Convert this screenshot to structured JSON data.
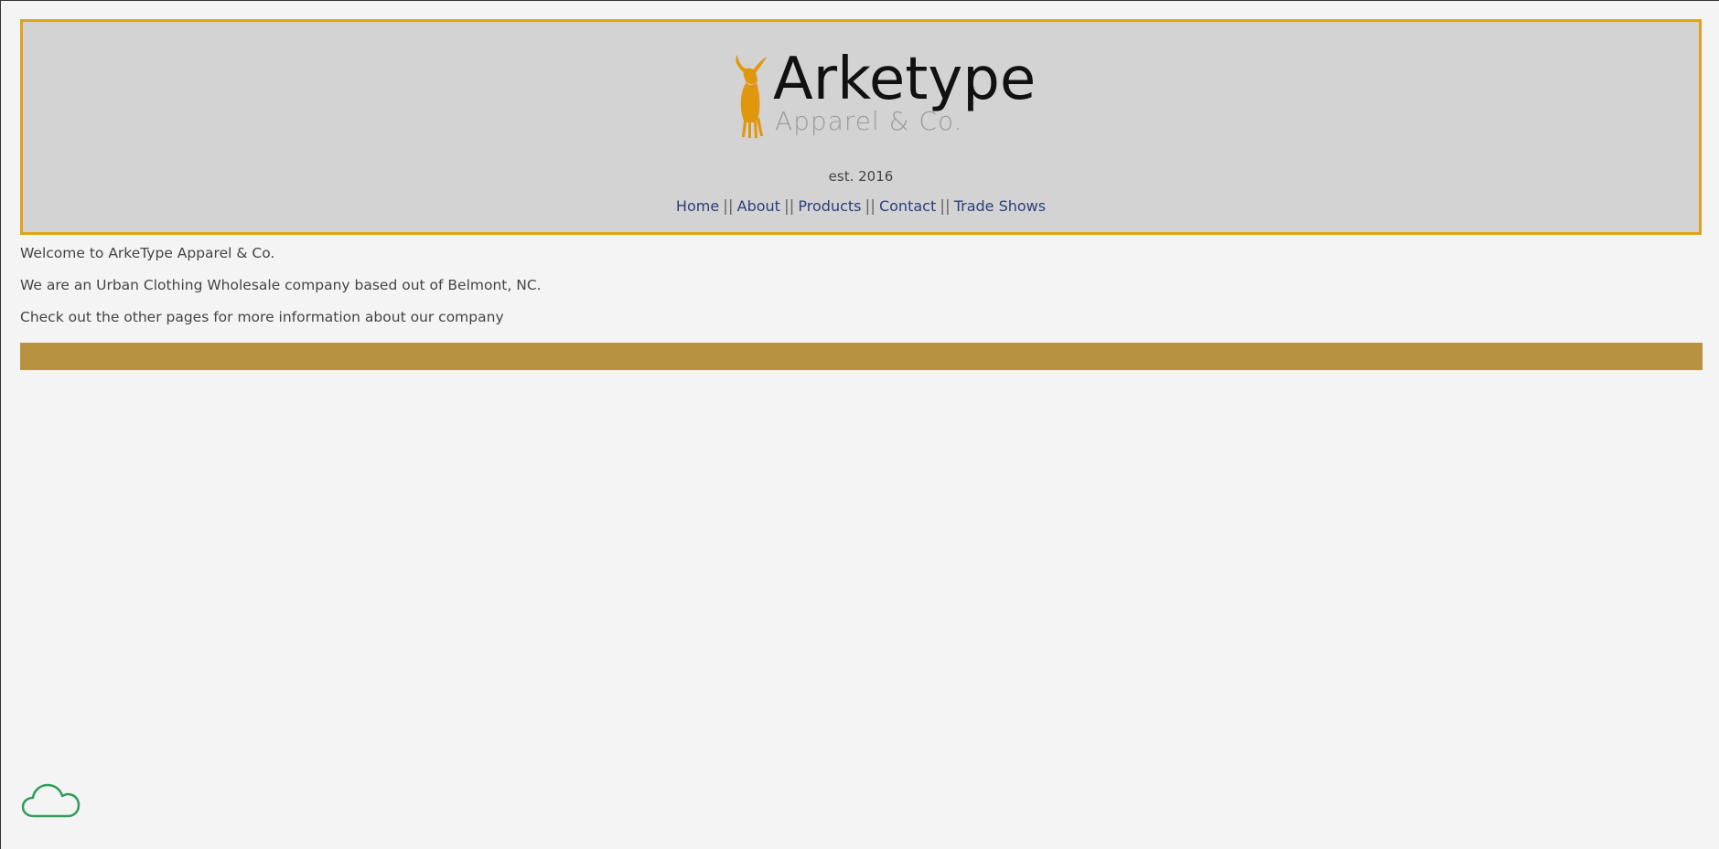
{
  "header": {
    "logo_title": "Arketype",
    "logo_subtitle": "Apparel & Co.",
    "established": "est. 2016",
    "nav": [
      {
        "label": "Home"
      },
      {
        "label": "About"
      },
      {
        "label": "Products"
      },
      {
        "label": "Contact"
      },
      {
        "label": "Trade Shows"
      }
    ],
    "nav_separator": "||"
  },
  "main": {
    "paragraphs": [
      "Welcome to ArkeType Apparel & Co.",
      "We are an Urban Clothing Wholesale company based out of Belmont, NC.",
      "Check out the other pages for more information about our company"
    ]
  },
  "colors": {
    "header_border": "#e3a11a",
    "header_bg": "#d3d3d3",
    "gold_bar": "#b8933f",
    "link": "#2a3f7a",
    "goat": "#e0970e",
    "cloud": "#2e9e5b"
  },
  "icons": {
    "logo": "goat-logo-icon",
    "cloud": "cloud-icon"
  }
}
